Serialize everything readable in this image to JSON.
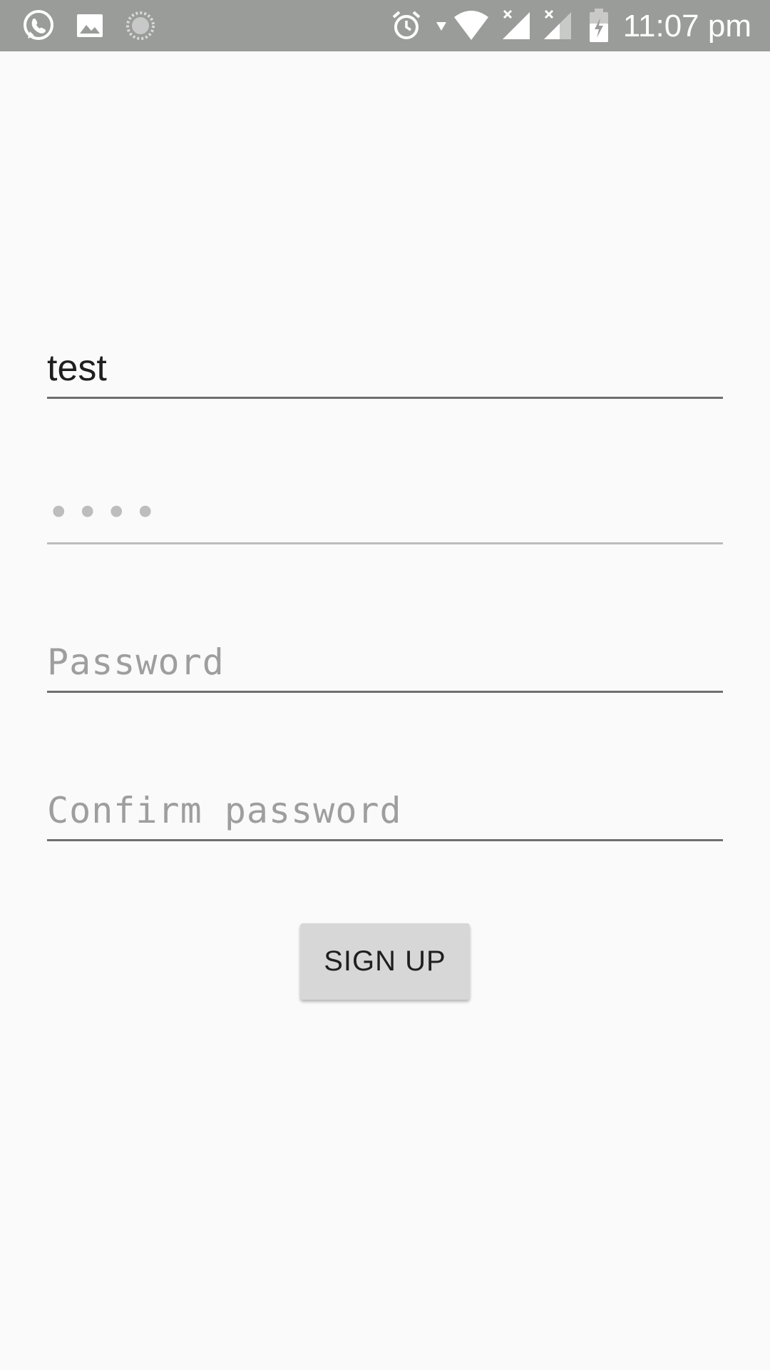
{
  "status_bar": {
    "background": "#9a9c99",
    "time": "11:07 pm",
    "left_icons": [
      "whatsapp-icon",
      "gallery-icon",
      "loading-icon"
    ],
    "right_icons": [
      "alarm-icon",
      "data-arrow-icon",
      "wifi-icon",
      "signal-icon",
      "signal-icon",
      "battery-charging-icon"
    ]
  },
  "form": {
    "username_value": "test",
    "masked_field_placeholder": "••••",
    "password_placeholder": "Password",
    "confirm_password_placeholder": "Confirm password",
    "signup_label": "SIGN UP"
  },
  "colors": {
    "background": "#fafafa",
    "button": "#d6d7d6",
    "text": "#1f1f1f",
    "hint": "#9e9e9e"
  }
}
